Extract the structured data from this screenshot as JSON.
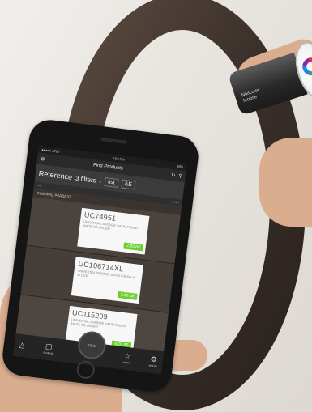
{
  "device": {
    "label_line1": "NixColor",
    "label_line2": "Mobile"
  },
  "phone": {
    "status": {
      "carrier": "●●●●● AT&T",
      "time": "3:58 PM",
      "battery": "89%"
    },
    "app_bar": {
      "title": "Find Products",
      "gear_icon": "⚙",
      "refresh_icon": "↻",
      "search_icon": "⚲"
    },
    "filter_bar": {
      "reference_label": "Reference",
      "filters_label": "3 filters",
      "chevron": "›",
      "list_label": "list",
      "delta_label": "ΔE"
    },
    "column_headers": {
      "left": "Sort",
      "right": "Match"
    },
    "matching_text": "matching #4A3A37",
    "results": [
      {
        "sku": "UC74951",
        "desc": "UNIVERSAL BRONZE SATIN FINISH MADE TO ORDER",
        "match": "2.50 ΔE"
      },
      {
        "sku": "UC106714XL",
        "desc": "UNIVERSAL BRONZE SATIN FINISH IN STOCK",
        "match": "3.60 ΔE"
      },
      {
        "sku": "UC115209",
        "desc": "UNIVERSAL BRONZE SATIN FINISH MADE TO ORDER",
        "match": "4.10 ΔE"
      }
    ],
    "bottom_nav": {
      "scan_label": "SCAN",
      "items": [
        {
          "icon": "△",
          "label": ""
        },
        {
          "icon": "▢",
          "label": "products"
        },
        {
          "icon": "☆",
          "label": "saved"
        },
        {
          "icon": "⚙",
          "label": "settings"
        }
      ]
    }
  }
}
